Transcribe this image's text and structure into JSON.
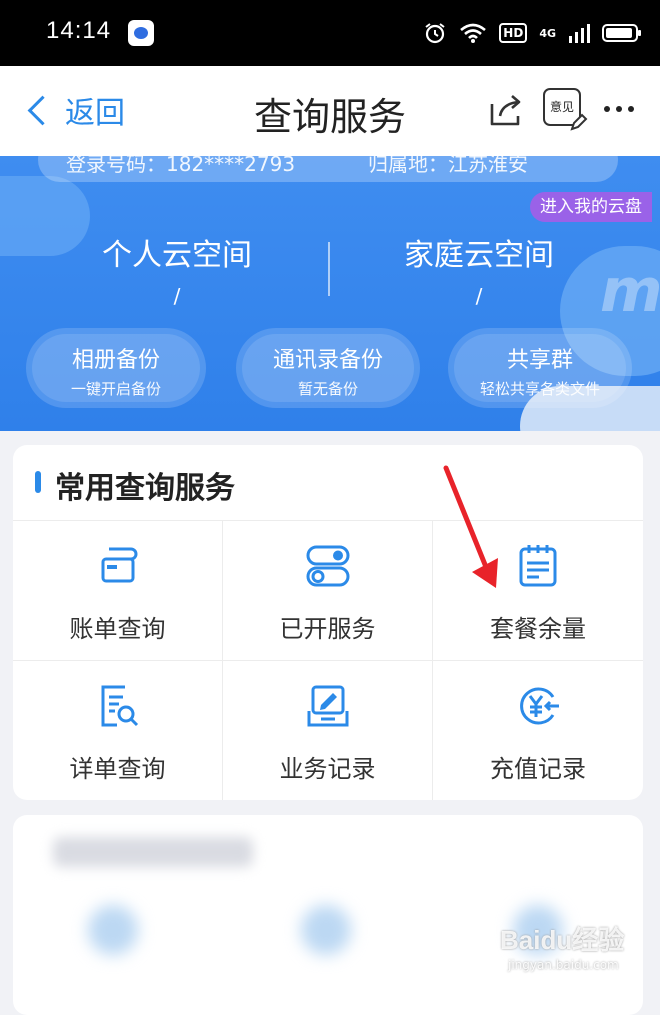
{
  "status_bar": {
    "time": "14:14",
    "hd_label": "HD",
    "network": "4G"
  },
  "nav": {
    "back_label": "返回",
    "title": "查询服务",
    "feedback_label": "意见"
  },
  "banner": {
    "login_number": "登录号码：182****2793",
    "login_region": "归属地：江苏淮安",
    "cloud_tag": "进入我的云盘",
    "personal_space": "个人云空间",
    "personal_value": "/",
    "family_space": "家庭云空间",
    "family_value": "/",
    "pills": [
      {
        "title": "相册备份",
        "sub": "一键开启备份"
      },
      {
        "title": "通讯录备份",
        "sub": "暂无备份"
      },
      {
        "title": "共享群",
        "sub": "轻松共享各类文件"
      }
    ]
  },
  "card": {
    "title": "常用查询服务",
    "items": [
      {
        "label": "账单查询",
        "icon": "bill-icon"
      },
      {
        "label": "已开服务",
        "icon": "toggle-icon"
      },
      {
        "label": "套餐余量",
        "icon": "calendar-icon"
      },
      {
        "label": "详单查询",
        "icon": "document-search-icon"
      },
      {
        "label": "业务记录",
        "icon": "edit-record-icon"
      },
      {
        "label": "充值记录",
        "icon": "yen-icon"
      }
    ]
  },
  "watermark": {
    "brand": "Baidu经验",
    "url": "jingyan.baidu.com"
  },
  "colors": {
    "accent": "#2b8ae8",
    "banner": "#3f8df0",
    "tag": "#9a62e8",
    "arrow": "#e8232a"
  }
}
